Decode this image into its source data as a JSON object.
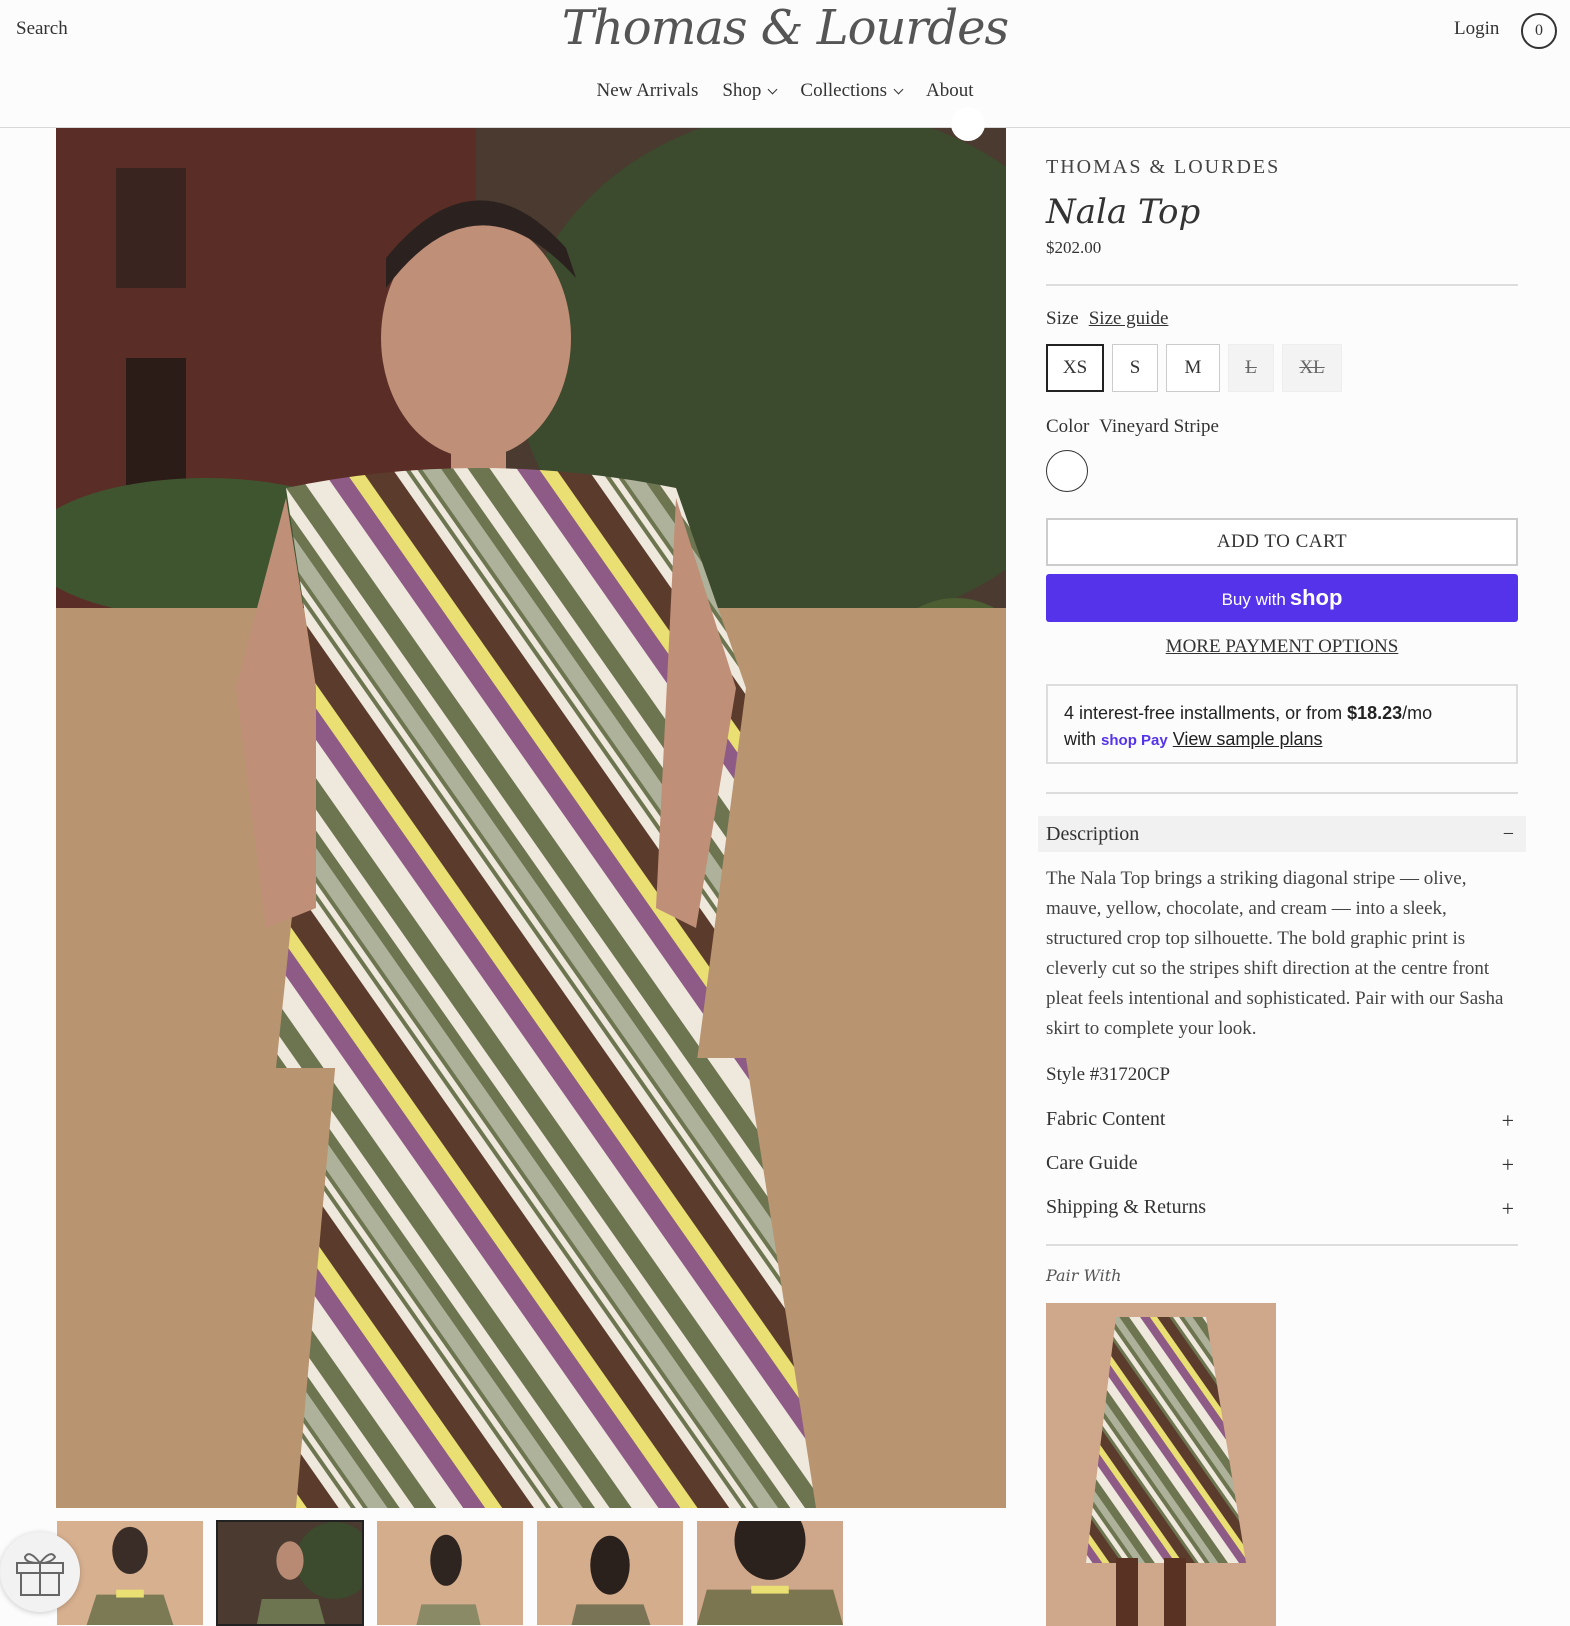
{
  "header": {
    "search_label": "Search",
    "logo_text": "Thomas & Lourdes",
    "login_label": "Login",
    "cart_count": "0",
    "nav": [
      {
        "label": "New Arrivals"
      },
      {
        "label": "Shop"
      },
      {
        "label": "Collections"
      },
      {
        "label": "About"
      }
    ]
  },
  "product": {
    "vendor": "THOMAS & LOURDES",
    "title": "Nala Top",
    "price": "$202.00",
    "size_label": "Size",
    "size_guide": "Size guide",
    "sizes": [
      "XS",
      "S",
      "M",
      "L",
      "XL"
    ],
    "selected_size": "XS",
    "unavailable_sizes": [
      "L",
      "XL"
    ],
    "color_label": "Color",
    "color_value": "Vineyard Stripe",
    "add_to_cart": "ADD TO CART",
    "buy_with": "Buy with",
    "shop_brand": "shop",
    "more_payment": "MORE PAYMENT OPTIONS",
    "installments": {
      "text_1": "4 interest-free installments, or from ",
      "amount": "$18.23",
      "text_2": "/mo",
      "with": "with",
      "shop_pay": "shop Pay",
      "link": "View sample plans"
    },
    "description_title": "Description",
    "description": "The Nala Top brings a striking diagonal stripe — olive, mauve, yellow, chocolate, and cream — into a sleek, structured crop top silhouette. The bold graphic print is cleverly cut so the stripes shift direction at the centre front pleat feels intentional and sophisticated.  Pair with our Sasha skirt to complete your look.",
    "style_number": "Style #31720CP",
    "accordions": [
      {
        "label": "Fabric Content"
      },
      {
        "label": "Care Guide"
      },
      {
        "label": "Shipping & Returns"
      }
    ],
    "pair_with": "Pair With"
  },
  "colors": {
    "shop_pay_purple": "#5433eb",
    "olive": "#6c7550",
    "mauve": "#8e5a86",
    "yellow": "#e9df72",
    "chocolate": "#5b3b2b",
    "cream": "#efe8dc"
  }
}
